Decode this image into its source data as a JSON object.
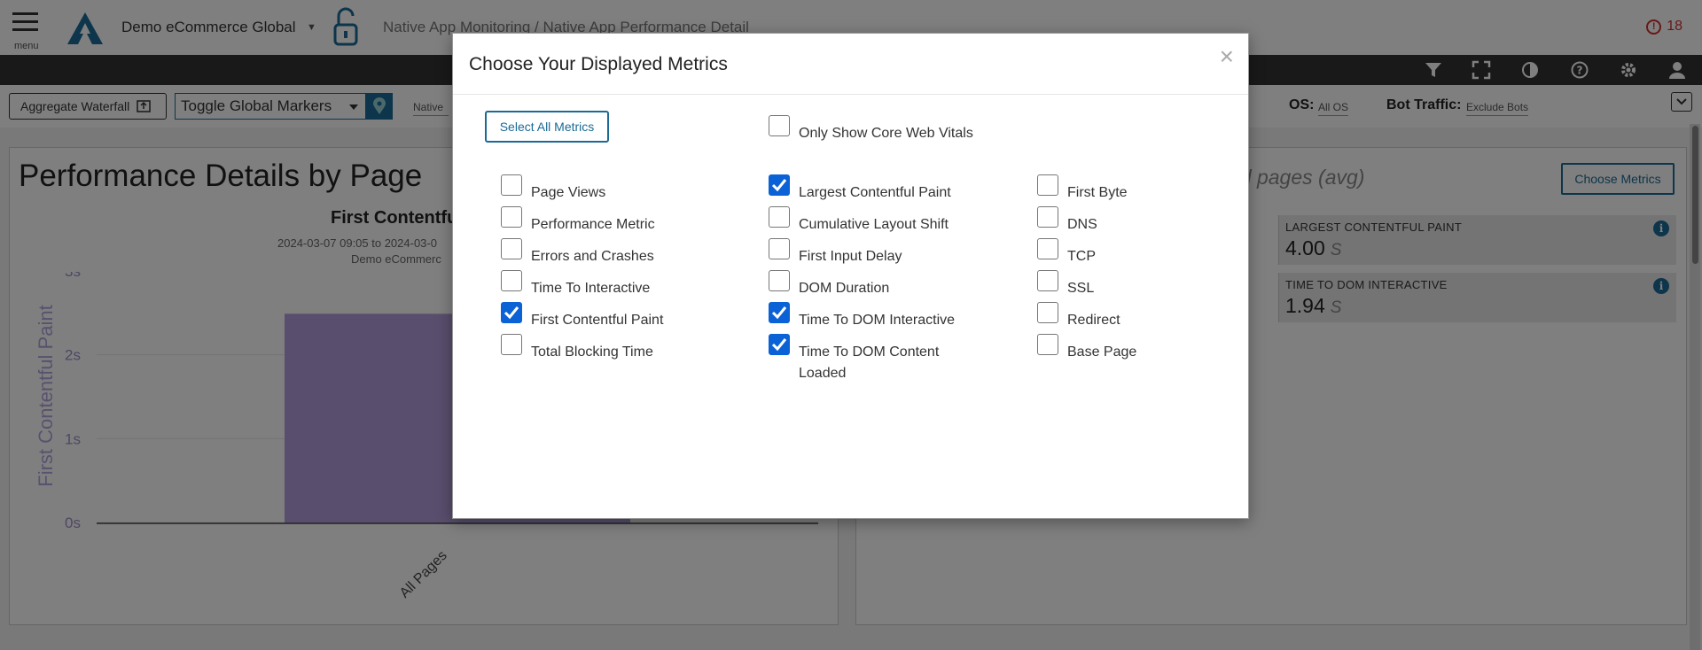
{
  "header": {
    "menu_label": "menu",
    "org_name": "Demo eCommerce Global",
    "breadcrumb": "Native App Monitoring / Native App Performance Detail",
    "alert_count": "18"
  },
  "controls": {
    "aggregate_waterfall": "Aggregate Waterfall",
    "toggle_global_markers": "Toggle Global Markers",
    "native_filter": "Native",
    "os_label": "OS:",
    "os_value": "All OS",
    "bot_label": "Bot Traffic:",
    "bot_value": "Exclude Bots"
  },
  "left_panel": {
    "title": "Performance Details by Page",
    "chart_title": "First Contentfu",
    "chart_date": "2024-03-07 09:05 to 2024-03-0",
    "chart_org": "Demo eCommerc"
  },
  "chart_data": {
    "type": "bar",
    "categories": [
      "All Pages"
    ],
    "values": [
      2.5
    ],
    "ylabel": "First Contentful Paint",
    "yticks": [
      "0s",
      "1s",
      "2s",
      "3s"
    ],
    "ylim": [
      0,
      3
    ],
    "bar_color": "#b39ddb"
  },
  "right_panel": {
    "title": "ed pages (avg)",
    "choose_metrics": "Choose Metrics",
    "kpis": [
      {
        "name": "LARGEST CONTENTFUL PAINT",
        "value": "4.00",
        "unit": "S"
      },
      {
        "name": "TIME TO DOM INTERACTIVE",
        "value": "1.94",
        "unit": "S"
      }
    ]
  },
  "modal": {
    "title": "Choose Your Displayed Metrics",
    "close": "×",
    "select_all": "Select All Metrics",
    "core_web_vitals": {
      "label": "Only Show Core Web Vitals",
      "checked": false
    },
    "col1": [
      {
        "label": "Page Views",
        "checked": false
      },
      {
        "label": "Performance Metric",
        "checked": false
      },
      {
        "label": "Errors and Crashes",
        "checked": false
      },
      {
        "label": "Time To Interactive",
        "checked": false
      },
      {
        "label": "First Contentful Paint",
        "checked": true
      },
      {
        "label": "Total Blocking Time",
        "checked": false
      }
    ],
    "col2": [
      {
        "label": "Largest Contentful Paint",
        "checked": true
      },
      {
        "label": "Cumulative Layout Shift",
        "checked": false
      },
      {
        "label": "First Input Delay",
        "checked": false
      },
      {
        "label": "DOM Duration",
        "checked": false
      },
      {
        "label": "Time To DOM Interactive",
        "checked": true
      },
      {
        "label": "Time To DOM Content Loaded",
        "checked": true
      }
    ],
    "col3": [
      {
        "label": "First Byte",
        "checked": false
      },
      {
        "label": "DNS",
        "checked": false
      },
      {
        "label": "TCP",
        "checked": false
      },
      {
        "label": "SSL",
        "checked": false
      },
      {
        "label": "Redirect",
        "checked": false
      },
      {
        "label": "Base Page",
        "checked": false
      }
    ]
  },
  "colors": {
    "accent": "#1b6a96",
    "checkbox_checked": "#0b62d6",
    "alert": "#d32f2f",
    "toolbar": "#333333"
  }
}
